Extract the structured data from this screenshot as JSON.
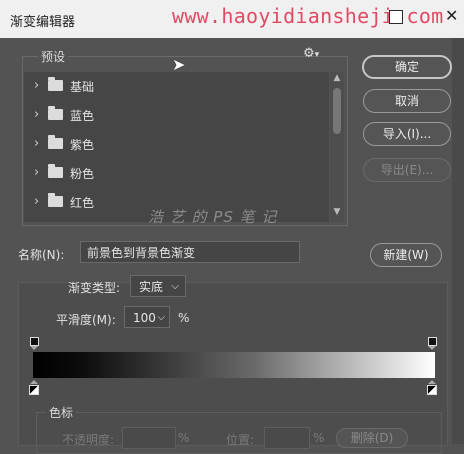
{
  "window": {
    "title": "渐变编辑器"
  },
  "watermark": {
    "url": "www.haoyidiansheji.com",
    "brand": "浩 艺 的 PS 笔 记"
  },
  "presets": {
    "label": "预设",
    "items": [
      {
        "label": "基础"
      },
      {
        "label": "蓝色"
      },
      {
        "label": "紫色"
      },
      {
        "label": "粉色"
      },
      {
        "label": "红色"
      }
    ]
  },
  "buttons": {
    "ok": "确定",
    "cancel": "取消",
    "import": "导入(I)...",
    "export": "导出(E)...",
    "new": "新建(W)",
    "delete": "删除(D)"
  },
  "name": {
    "label": "名称(N):",
    "value": "前景色到背景色渐变"
  },
  "gradient": {
    "type_label": "渐变类型:",
    "type_value": "实底",
    "smoothness_label": "平滑度(M):",
    "smoothness_value": "100",
    "percent": "%"
  },
  "stops": {
    "label": "色标",
    "opacity_label": "不透明度:",
    "percent": "%",
    "location_label": "位置:",
    "location_percent": "%"
  },
  "colors": {
    "accent_url": "#e24a64",
    "bg": "#535353"
  }
}
